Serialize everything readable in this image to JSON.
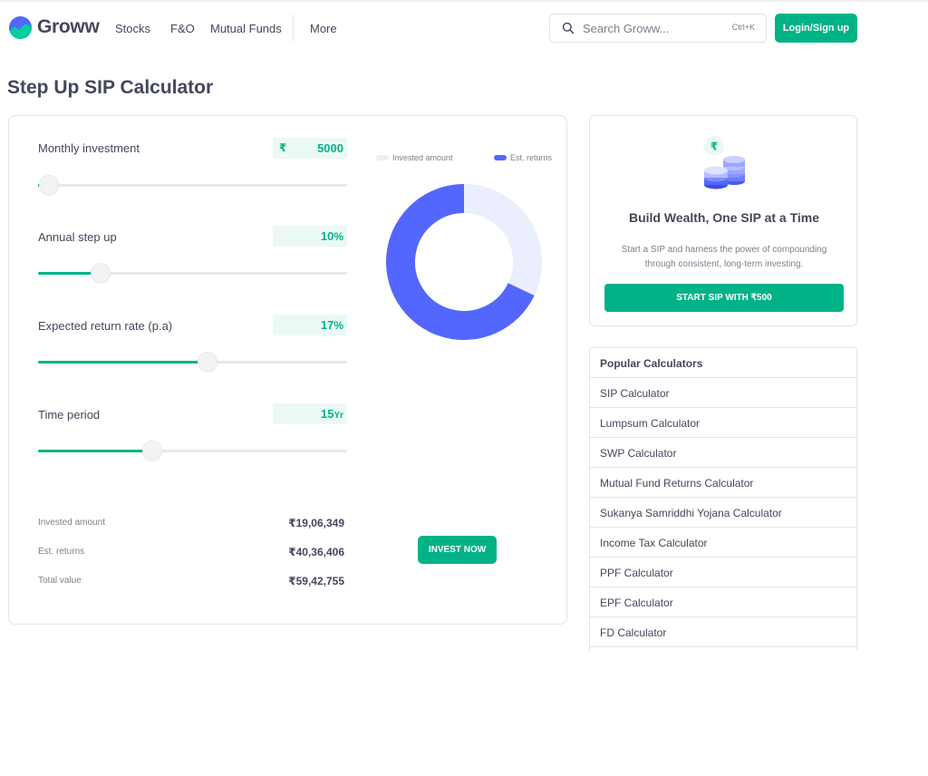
{
  "header": {
    "brand": "Groww",
    "nav": [
      "Stocks",
      "F&O",
      "Mutual Funds",
      "More"
    ],
    "search_placeholder": "Search Groww...",
    "search_shortcut": "Ctrl+K",
    "login_label": "Login/Sign up"
  },
  "page_title": "Step Up SIP Calculator",
  "calculator": {
    "fields": [
      {
        "label": "Monthly investment",
        "prefix": "₹",
        "value": "5000",
        "unit": "",
        "slider_fraction": 0.0
      },
      {
        "label": "Annual step up",
        "prefix": "",
        "value": "10",
        "unit": "%",
        "slider_fraction": 0.2
      },
      {
        "label": "Expected return rate (p.a)",
        "prefix": "",
        "value": "17",
        "unit": "%",
        "slider_fraction": 0.55
      },
      {
        "label": "Time period",
        "prefix": "",
        "value": "15",
        "unit": "Yr",
        "slider_fraction": 0.37
      }
    ],
    "legend": {
      "invested": "Invested amount",
      "returns": "Est. returns"
    },
    "summary": [
      {
        "label": "Invested amount",
        "value": "₹19,06,349"
      },
      {
        "label": "Est. returns",
        "value": "₹40,36,406"
      },
      {
        "label": "Total value",
        "value": "₹59,42,755"
      }
    ],
    "invest_button": "INVEST NOW",
    "colors": {
      "invested": "#ebeefc",
      "returns": "#5367ff",
      "accent": "#00b386"
    }
  },
  "chart_data": {
    "type": "pie",
    "categories": [
      "Invested amount",
      "Est. returns"
    ],
    "values": [
      1906349,
      4036406
    ]
  },
  "promo": {
    "icon_symbol": "₹",
    "title": "Build Wealth, One SIP at a Time",
    "text": "Start a SIP and harness the power of compounding through consistent, long-term investing.",
    "button": "START SIP WITH ₹500"
  },
  "popular": {
    "title": "Popular Calculators",
    "items": [
      "SIP Calculator",
      "Lumpsum Calculator",
      "SWP Calculator",
      "Mutual Fund Returns Calculator",
      "Sukanya Samriddhi Yojana Calculator",
      "Income Tax Calculator",
      "PPF Calculator",
      "EPF Calculator",
      "FD Calculator"
    ]
  }
}
